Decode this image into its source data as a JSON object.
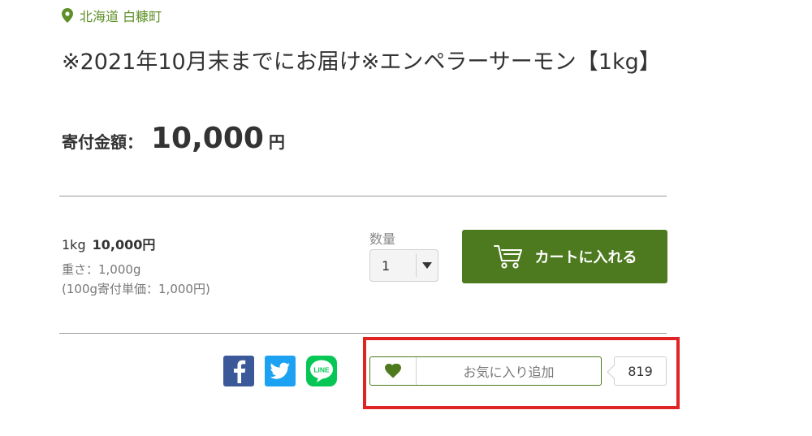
{
  "location": {
    "text": "北海道 白糠町",
    "icon": "map-pin-icon"
  },
  "product": {
    "title": "※2021年10月末までにお届け※エンペラーサーモン【1kg】",
    "price_label": "寄付金額：",
    "price_amount": "10,000",
    "price_unit": "円"
  },
  "variant": {
    "size": "1kg",
    "price": "10,000円",
    "weight": "重さ：1,000g",
    "unit_price": "(100g寄付単価：1,000円)"
  },
  "quantity": {
    "label": "数量",
    "value": "1"
  },
  "cart": {
    "label": "カートに入れる"
  },
  "social": {
    "facebook": "facebook-icon",
    "twitter": "twitter-icon",
    "line_label": "LINE"
  },
  "favorite": {
    "label": "お気に入り追加",
    "count": "819"
  },
  "colors": {
    "accent_green": "#4d7a1e",
    "highlight_red": "#e02424"
  }
}
